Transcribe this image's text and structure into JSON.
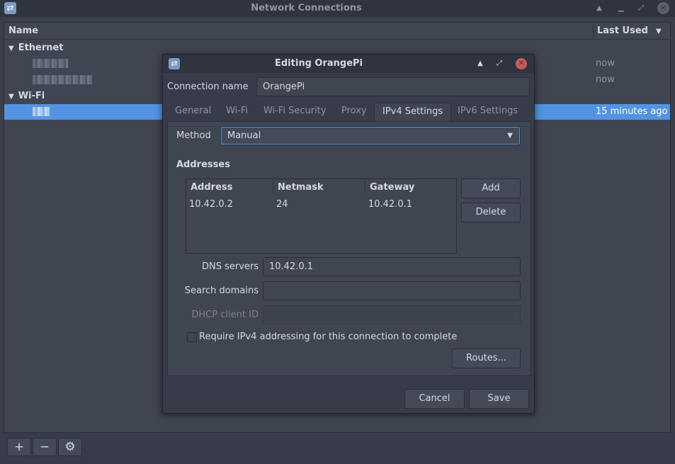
{
  "window": {
    "title": "Network Connections",
    "columns": {
      "name": "Name",
      "last_used": "Last Used"
    },
    "groups": [
      {
        "label": "Ethernet",
        "connections": [
          {
            "last_used": "now"
          },
          {
            "last_used": "now"
          }
        ]
      },
      {
        "label": "Wi-Fi",
        "connections": [
          {
            "last_used": "15 minutes ago",
            "selected": true
          }
        ]
      }
    ],
    "toolbar": {
      "add": "+",
      "remove": "−",
      "settings": "⚙"
    }
  },
  "dialog": {
    "title": "Editing OrangePi",
    "connection_name_label": "Connection name",
    "connection_name_value": "OrangePi",
    "tabs": [
      {
        "label": "General"
      },
      {
        "label": "Wi-Fi"
      },
      {
        "label": "Wi-Fi Security"
      },
      {
        "label": "Proxy"
      },
      {
        "label": "IPv4 Settings",
        "active": true
      },
      {
        "label": "IPv6 Settings"
      }
    ],
    "ipv4": {
      "method_label": "Method",
      "method_value": "Manual",
      "addresses_heading": "Addresses",
      "table_headers": {
        "address": "Address",
        "netmask": "Netmask",
        "gateway": "Gateway"
      },
      "rows": [
        {
          "address": "10.42.0.2",
          "netmask": "24",
          "gateway": "10.42.0.1"
        }
      ],
      "add_button": "Add",
      "delete_button": "Delete",
      "dns_label": "DNS servers",
      "dns_value": "10.42.0.1",
      "search_domains_label": "Search domains",
      "search_domains_value": "",
      "dhcp_client_id_label": "DHCP client ID",
      "dhcp_client_id_value": "",
      "require_ipv4_label": "Require IPv4 addressing for this connection to complete",
      "require_ipv4_checked": false,
      "routes_button": "Routes..."
    },
    "cancel_button": "Cancel",
    "save_button": "Save"
  },
  "colors": {
    "selection": "#5294e2",
    "close_button": "#cc575d",
    "background": "#383c4a",
    "titlebar": "#2f343f"
  }
}
